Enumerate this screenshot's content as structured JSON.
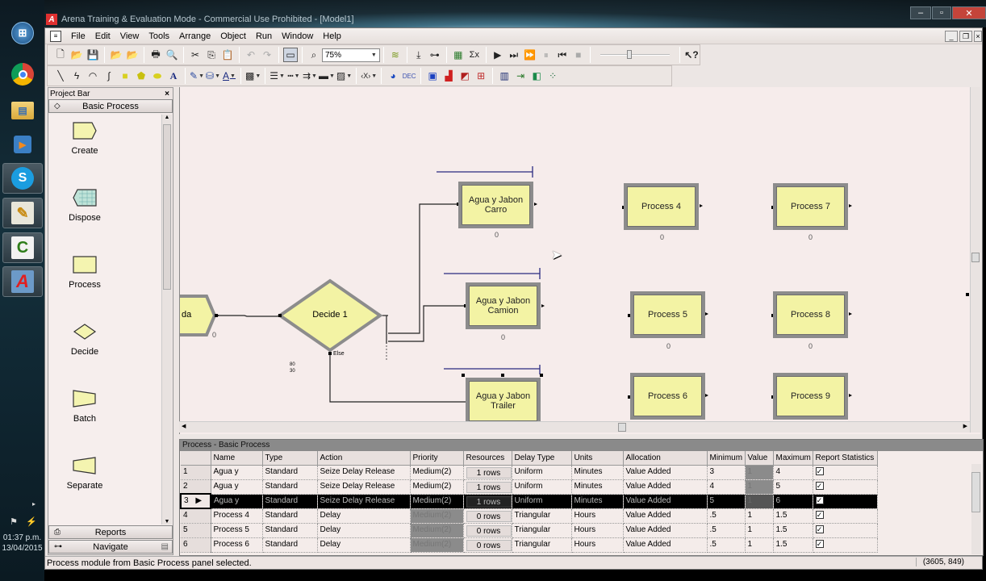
{
  "window": {
    "title": "Arena Training & Evaluation Mode - Commercial Use Prohibited - [Model1]",
    "app_logo": "A"
  },
  "taskbar": {
    "items": [
      {
        "name": "windows-start",
        "label": "⊞"
      },
      {
        "name": "chrome",
        "label": "◉"
      },
      {
        "name": "file-explorer",
        "label": "▤"
      },
      {
        "name": "media-player",
        "label": "▶"
      },
      {
        "name": "skype",
        "label": "S"
      },
      {
        "name": "notepad",
        "label": "✎"
      },
      {
        "name": "camtasia",
        "label": "C"
      },
      {
        "name": "arena",
        "label": "A"
      }
    ],
    "time": "01:37 p.m.",
    "date": "13/04/2015"
  },
  "menu": {
    "items": [
      "File",
      "Edit",
      "View",
      "Tools",
      "Arrange",
      "Object",
      "Run",
      "Window",
      "Help"
    ]
  },
  "toolbar": {
    "zoom_value": "75%"
  },
  "project_bar": {
    "title": "Project Bar",
    "close": "×",
    "panel_title": "Basic Process",
    "modules": [
      {
        "name": "create",
        "label": "Create"
      },
      {
        "name": "dispose",
        "label": "Dispose"
      },
      {
        "name": "process",
        "label": "Process"
      },
      {
        "name": "decide",
        "label": "Decide"
      },
      {
        "name": "batch",
        "label": "Batch"
      },
      {
        "name": "separate",
        "label": "Separate"
      }
    ],
    "bottom_tabs": [
      {
        "name": "reports",
        "label": "Reports"
      },
      {
        "name": "navigate",
        "label": "Navigate"
      }
    ]
  },
  "canvas": {
    "create_partial_label": "da",
    "create_counter": "0",
    "decide": {
      "label": "Decide 1",
      "else_label": "Else",
      "pct_1": "80",
      "pct_2": "30"
    },
    "processes": [
      {
        "id": "carro",
        "label_1": "Agua y Jabon",
        "label_2": "Carro",
        "counter": "0"
      },
      {
        "id": "camion",
        "label_1": "Agua y Jabon",
        "label_2": "Camion",
        "counter": "0"
      },
      {
        "id": "trailer",
        "label_1": "Agua y Jabon",
        "label_2": "Trailer",
        "counter": ""
      },
      {
        "id": "p4",
        "label_1": "Process 4",
        "label_2": "",
        "counter": "0"
      },
      {
        "id": "p5",
        "label_1": "Process 5",
        "label_2": "",
        "counter": "0"
      },
      {
        "id": "p6",
        "label_1": "Process 6",
        "label_2": "",
        "counter": ""
      },
      {
        "id": "p7",
        "label_1": "Process 7",
        "label_2": "",
        "counter": "0"
      },
      {
        "id": "p8",
        "label_1": "Process 8",
        "label_2": "",
        "counter": "0"
      },
      {
        "id": "p9",
        "label_1": "Process 9",
        "label_2": "",
        "counter": ""
      }
    ]
  },
  "sheet": {
    "title": "Process - Basic Process",
    "columns": [
      "",
      "Name",
      "Type",
      "Action",
      "Priority",
      "Resources",
      "Delay Type",
      "Units",
      "Allocation",
      "Minimum",
      "Value",
      "Maximum",
      "Report Statistics"
    ],
    "rows": [
      {
        "n": "1",
        "name": "Agua y",
        "type": "Standard",
        "action": "Seize Delay Release",
        "priority": "Medium(2)",
        "resources": "1 rows",
        "delay_type": "Uniform",
        "units": "Minutes",
        "allocation": "Value Added",
        "min": "3",
        "value": "1",
        "max": "4",
        "report": true,
        "selected": false,
        "priority_disabled": false,
        "value_disabled": true
      },
      {
        "n": "2",
        "name": "Agua y",
        "type": "Standard",
        "action": "Seize Delay Release",
        "priority": "Medium(2)",
        "resources": "1 rows",
        "delay_type": "Uniform",
        "units": "Minutes",
        "allocation": "Value Added",
        "min": "4",
        "value": "1",
        "max": "5",
        "report": true,
        "selected": false,
        "priority_disabled": false,
        "value_disabled": true
      },
      {
        "n": "3",
        "name": "Agua y",
        "type": "Standard",
        "action": "Seize Delay Release",
        "priority": "Medium(2)",
        "resources": "1 rows",
        "delay_type": "Uniform",
        "units": "Minutes",
        "allocation": "Value Added",
        "min": "5",
        "value": "1",
        "max": "6",
        "report": true,
        "selected": true,
        "priority_disabled": false,
        "value_disabled": true
      },
      {
        "n": "4",
        "name": "Process 4",
        "type": "Standard",
        "action": "Delay",
        "priority": "Medium(2)",
        "resources": "0 rows",
        "delay_type": "Triangular",
        "units": "Hours",
        "allocation": "Value Added",
        "min": ".5",
        "value": "1",
        "max": "1.5",
        "report": true,
        "selected": false,
        "priority_disabled": true,
        "value_disabled": false
      },
      {
        "n": "5",
        "name": "Process 5",
        "type": "Standard",
        "action": "Delay",
        "priority": "Medium(2)",
        "resources": "0 rows",
        "delay_type": "Triangular",
        "units": "Hours",
        "allocation": "Value Added",
        "min": ".5",
        "value": "1",
        "max": "1.5",
        "report": true,
        "selected": false,
        "priority_disabled": true,
        "value_disabled": false
      },
      {
        "n": "6",
        "name": "Process 6",
        "type": "Standard",
        "action": "Delay",
        "priority": "Medium(2)",
        "resources": "0 rows",
        "delay_type": "Triangular",
        "units": "Hours",
        "allocation": "Value Added",
        "min": ".5",
        "value": "1",
        "max": "1.5",
        "report": true,
        "selected": false,
        "priority_disabled": true,
        "value_disabled": false
      }
    ]
  },
  "status": {
    "message": "Process module from Basic Process panel selected.",
    "coords": "(3605, 849)"
  }
}
